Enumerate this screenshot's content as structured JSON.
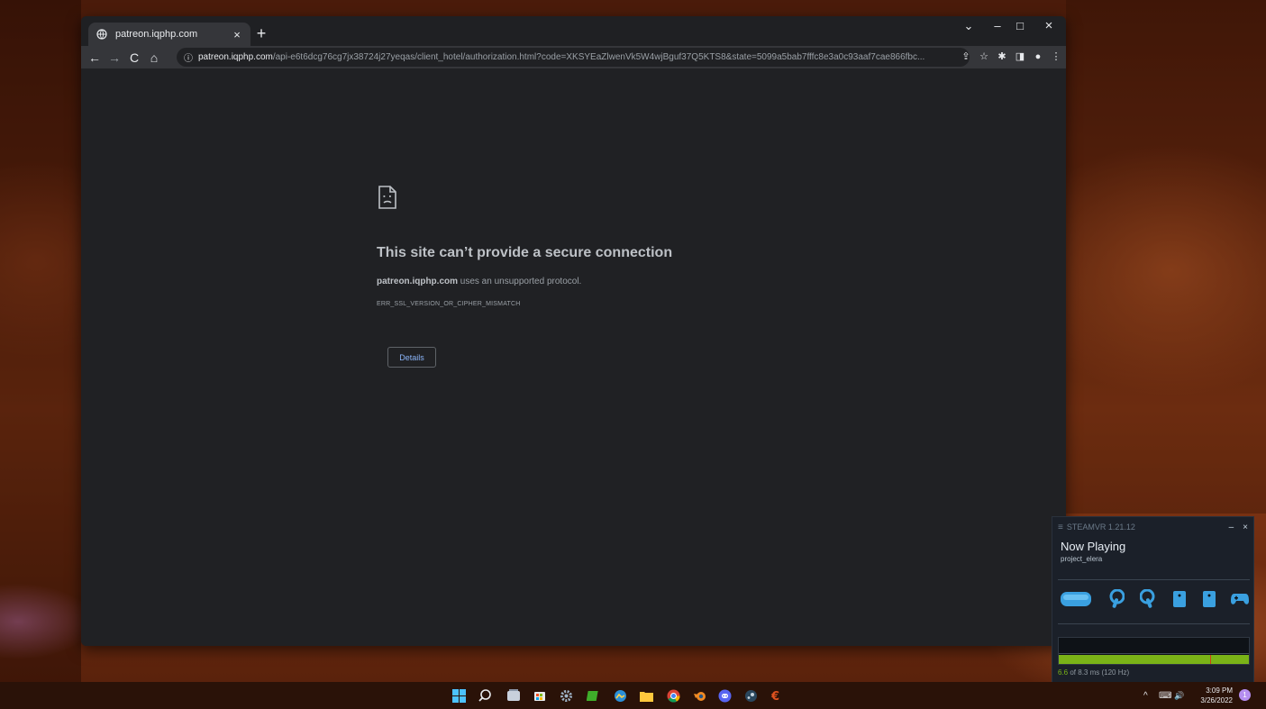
{
  "browser": {
    "tab": {
      "title": "patreon.iqphp.com",
      "close": "×"
    },
    "new_tab": "+",
    "window_controls": {
      "tabsearch": "⌄",
      "minimize": "–",
      "maximize": "□",
      "close": "×"
    },
    "nav": {
      "back": "←",
      "forward": "→",
      "reload": "C",
      "home": "⌂"
    },
    "omnibox": {
      "info": "ⓘ",
      "host": "patreon.iqphp.com",
      "path": "/api-e6t6dcg76cg7jx38724j27yeqas/client_hotel/authorization.html?code=XKSYEaZlwenVk5W4wjBguf37Q5KTS8&state=5099a5bab7fffc8e3a0c93aaf7cae866fbc..."
    },
    "toolbar_right": {
      "share": "⇪",
      "bookmark": "☆",
      "extensions": "✱",
      "sidepanel": "◨",
      "profile": "●",
      "menu": "⋮"
    }
  },
  "error_page": {
    "title": "This site can’t provide a secure connection",
    "host": "patreon.iqphp.com",
    "description": " uses an unsupported protocol.",
    "code": "ERR_SSL_VERSION_OR_CIPHER_MISMATCH",
    "details_button": "Details"
  },
  "steamvr": {
    "menu_icon": "≡",
    "version": "STEAMVR 1.21.12",
    "minimize": "–",
    "close": "×",
    "now_playing": "Now Playing",
    "app_name": "project_elera",
    "frame_time_value": "6.6",
    "frame_time_rest": " of 8.3 ms (120 Hz)",
    "frame_fraction": 0.795
  },
  "taskbar": {
    "clock_time": "3:09 PM",
    "clock_date": "3/26/2022",
    "notification_count": "1",
    "tray_chevron": "^",
    "tray_net": "⌨",
    "tray_vol": "🔊"
  },
  "colors": {
    "accent_link": "#8ab4f8",
    "steamvr_green": "#7ab317"
  }
}
